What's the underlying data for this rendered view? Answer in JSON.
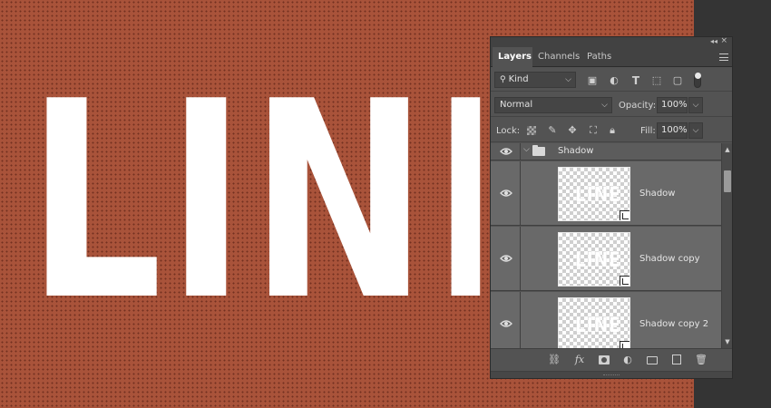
{
  "canvas": {
    "text": "LINE",
    "background_color": "#a9533a",
    "text_color": "#ffffff"
  },
  "panel": {
    "tabs": [
      {
        "label": "Layers",
        "active": true
      },
      {
        "label": "Channels",
        "active": false
      },
      {
        "label": "Paths",
        "active": false
      }
    ],
    "filter": {
      "kind_label": "Kind"
    },
    "blend": {
      "mode": "Normal",
      "opacity_label": "Opacity:",
      "opacity_value": "100%"
    },
    "lock": {
      "label": "Lock:",
      "fill_label": "Fill:",
      "fill_value": "100%"
    },
    "group": {
      "name": "Shadow",
      "expanded": true
    },
    "layers": [
      {
        "name": "Shadow",
        "thumb_text": "LINE"
      },
      {
        "name": "Shadow copy",
        "thumb_text": "LINE"
      },
      {
        "name": "Shadow copy 2",
        "thumb_text": "LINE"
      }
    ]
  },
  "colors": {
    "panel_bg": "#535353",
    "layer_row_bg": "#696969",
    "workspace_dark": "#343434"
  }
}
